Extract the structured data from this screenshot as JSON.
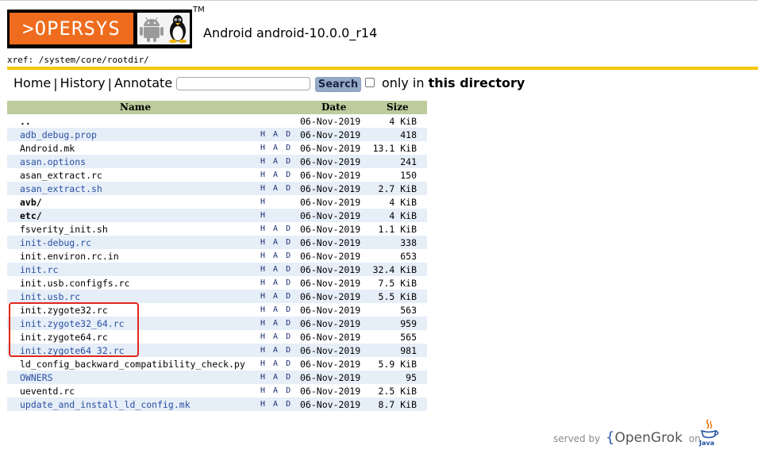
{
  "header": {
    "logo_text": ">OPERSYS",
    "trademark": "TM",
    "project_title": "Android android-10.0.0_r14",
    "xref": "xref: /system/core/rootdir/"
  },
  "nav": {
    "home": "Home",
    "history": "History",
    "annotate": "Annotate",
    "separator": "|",
    "search_value": "",
    "search_button": "Search",
    "only_in_prefix": "only in ",
    "only_in_bold": "this directory"
  },
  "table": {
    "headers": {
      "name": "Name",
      "date": "Date",
      "size": "Size"
    },
    "rows": [
      {
        "name": "..",
        "had": "",
        "date": "06-Nov-2019",
        "size": "4 KiB",
        "kind": "dir"
      },
      {
        "name": "adb_debug.prop",
        "had": "H A D",
        "date": "06-Nov-2019",
        "size": "418",
        "kind": "link"
      },
      {
        "name": "Android.mk",
        "had": "H A D",
        "date": "06-Nov-2019",
        "size": "13.1 KiB",
        "kind": "plain"
      },
      {
        "name": "asan.options",
        "had": "H A D",
        "date": "06-Nov-2019",
        "size": "241",
        "kind": "link"
      },
      {
        "name": "asan_extract.rc",
        "had": "H A D",
        "date": "06-Nov-2019",
        "size": "150",
        "kind": "plain"
      },
      {
        "name": "asan_extract.sh",
        "had": "H A D",
        "date": "06-Nov-2019",
        "size": "2.7 KiB",
        "kind": "link"
      },
      {
        "name": "avb/",
        "had": "H",
        "date": "06-Nov-2019",
        "size": "4 KiB",
        "kind": "dir"
      },
      {
        "name": "etc/",
        "had": "H",
        "date": "06-Nov-2019",
        "size": "4 KiB",
        "kind": "dir"
      },
      {
        "name": "fsverity_init.sh",
        "had": "H A D",
        "date": "06-Nov-2019",
        "size": "1.1 KiB",
        "kind": "plain"
      },
      {
        "name": "init-debug.rc",
        "had": "H A D",
        "date": "06-Nov-2019",
        "size": "338",
        "kind": "link"
      },
      {
        "name": "init.environ.rc.in",
        "had": "H A D",
        "date": "06-Nov-2019",
        "size": "653",
        "kind": "plain"
      },
      {
        "name": "init.rc",
        "had": "H A D",
        "date": "06-Nov-2019",
        "size": "32.4 KiB",
        "kind": "link"
      },
      {
        "name": "init.usb.configfs.rc",
        "had": "H A D",
        "date": "06-Nov-2019",
        "size": "7.5 KiB",
        "kind": "plain"
      },
      {
        "name": "init.usb.rc",
        "had": "H A D",
        "date": "06-Nov-2019",
        "size": "5.5 KiB",
        "kind": "link"
      },
      {
        "name": "init.zygote32.rc",
        "had": "H A D",
        "date": "06-Nov-2019",
        "size": "563",
        "kind": "plain"
      },
      {
        "name": "init.zygote32_64.rc",
        "had": "H A D",
        "date": "06-Nov-2019",
        "size": "959",
        "kind": "link"
      },
      {
        "name": "init.zygote64.rc",
        "had": "H A D",
        "date": "06-Nov-2019",
        "size": "565",
        "kind": "plain"
      },
      {
        "name": "init.zygote64_32.rc",
        "had": "H A D",
        "date": "06-Nov-2019",
        "size": "981",
        "kind": "link"
      },
      {
        "name": "ld_config_backward_compatibility_check.py",
        "had": "H A D",
        "date": "06-Nov-2019",
        "size": "5.9 KiB",
        "kind": "plain"
      },
      {
        "name": "OWNERS",
        "had": "H A D",
        "date": "06-Nov-2019",
        "size": "95",
        "kind": "link"
      },
      {
        "name": "ueventd.rc",
        "had": "H A D",
        "date": "06-Nov-2019",
        "size": "2.5 KiB",
        "kind": "plain"
      },
      {
        "name": "update_and_install_ld_config.mk",
        "had": "H A D",
        "date": "06-Nov-2019",
        "size": "8.7 KiB",
        "kind": "link"
      }
    ]
  },
  "footer": {
    "served_by": "served by",
    "opengrok_open": "{",
    "opengrok": "OpenGrok",
    "on": "on",
    "java": "Java"
  },
  "colors": {
    "brand_orange": "#ef6c1e",
    "gold_bar": "#f5c800",
    "header_green": "#bccc9c",
    "alt_row": "#e6eef8",
    "link_blue": "#2a4fa2",
    "highlight_red": "#e1261d"
  },
  "icons": [
    "android-icon",
    "linux-penguin-icon",
    "java-logo-icon"
  ]
}
